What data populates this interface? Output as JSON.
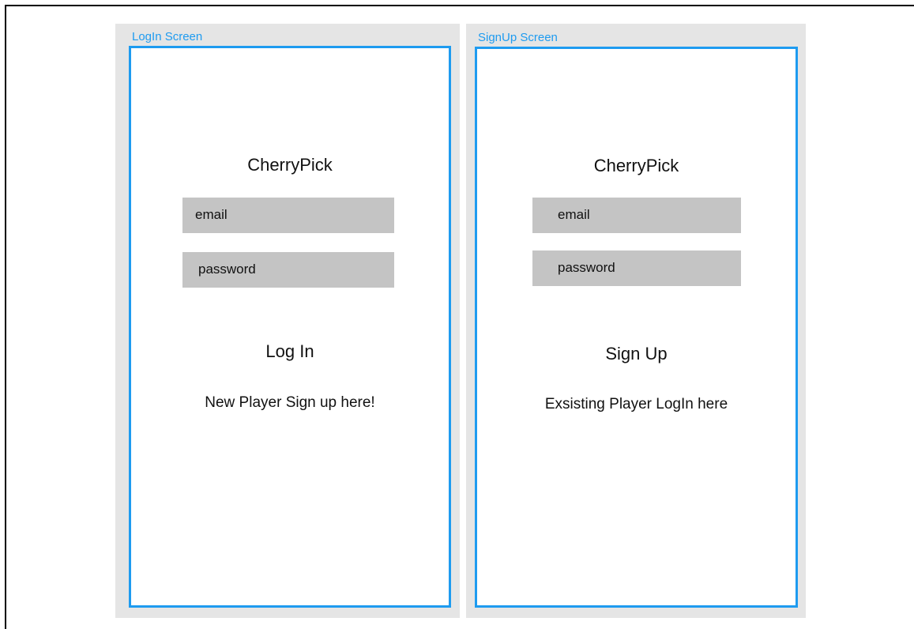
{
  "login_screen": {
    "frame_label": "LogIn Screen",
    "app_title": "CherryPick",
    "email_placeholder": "email",
    "password_placeholder": "password",
    "action_label": "Log In",
    "switch_link": "New Player Sign up here!"
  },
  "signup_screen": {
    "frame_label": "SignUp Screen",
    "app_title": "CherryPick",
    "email_placeholder": "email",
    "password_placeholder": "password",
    "action_label": "Sign Up",
    "switch_link": "Exsisting Player LogIn here"
  },
  "colors": {
    "frame_accent": "#1e9bf0",
    "panel_background": "#e5e5e5",
    "input_background": "#c4c4c4"
  }
}
